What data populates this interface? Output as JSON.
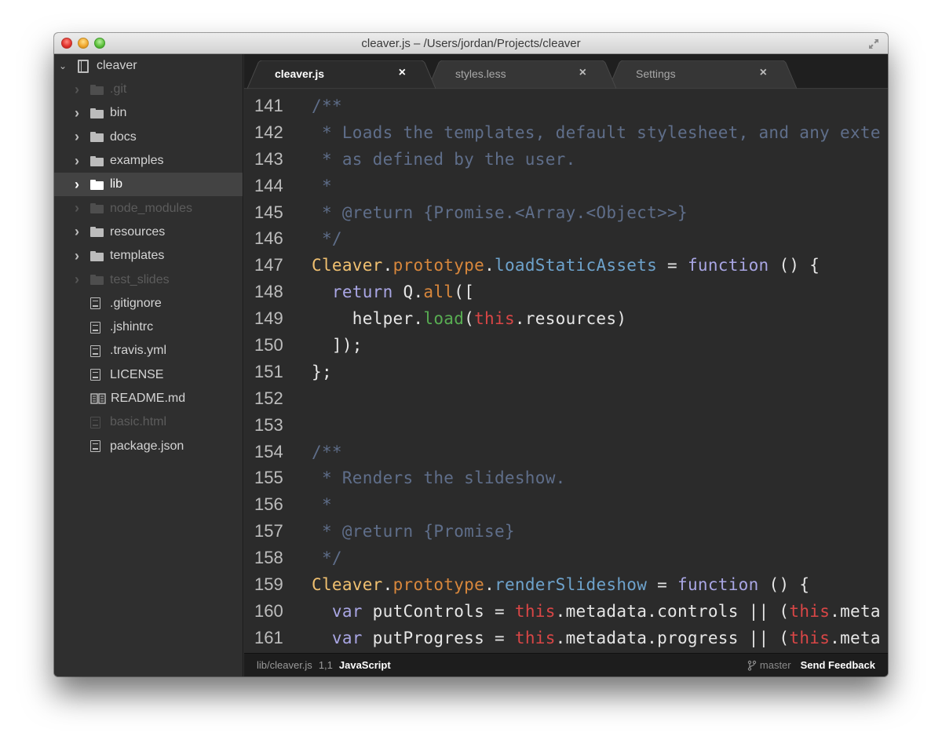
{
  "window": {
    "title": "cleaver.js – /Users/jordan/Projects/cleaver"
  },
  "sidebar": {
    "root": {
      "label": "cleaver",
      "icon": "repo-book-icon",
      "expanded": true
    },
    "items": [
      {
        "label": ".git",
        "type": "folder",
        "dim": true,
        "selected": false
      },
      {
        "label": "bin",
        "type": "folder",
        "dim": false,
        "selected": false
      },
      {
        "label": "docs",
        "type": "folder",
        "dim": false,
        "selected": false
      },
      {
        "label": "examples",
        "type": "folder",
        "dim": false,
        "selected": false
      },
      {
        "label": "lib",
        "type": "folder",
        "dim": false,
        "selected": true
      },
      {
        "label": "node_modules",
        "type": "folder",
        "dim": true,
        "selected": false
      },
      {
        "label": "resources",
        "type": "folder",
        "dim": false,
        "selected": false
      },
      {
        "label": "templates",
        "type": "folder",
        "dim": false,
        "selected": false
      },
      {
        "label": "test_slides",
        "type": "folder",
        "dim": true,
        "selected": false
      },
      {
        "label": ".gitignore",
        "type": "file",
        "dim": false,
        "selected": false
      },
      {
        "label": ".jshintrc",
        "type": "file",
        "dim": false,
        "selected": false
      },
      {
        "label": ".travis.yml",
        "type": "file",
        "dim": false,
        "selected": false
      },
      {
        "label": "LICENSE",
        "type": "file",
        "dim": false,
        "selected": false
      },
      {
        "label": "README.md",
        "type": "readme",
        "dim": false,
        "selected": false
      },
      {
        "label": "basic.html",
        "type": "file",
        "dim": true,
        "selected": false
      },
      {
        "label": "package.json",
        "type": "file",
        "dim": false,
        "selected": false
      }
    ]
  },
  "tabs": [
    {
      "label": "cleaver.js",
      "active": true,
      "close": "×"
    },
    {
      "label": "styles.less",
      "active": false,
      "close": "×"
    },
    {
      "label": "Settings",
      "active": false,
      "close": "×"
    }
  ],
  "editor": {
    "lines": [
      {
        "n": "141",
        "tokens": [
          [
            "comment",
            "/**"
          ]
        ]
      },
      {
        "n": "142",
        "tokens": [
          [
            "comment",
            " * Loads the templates, default stylesheet, and any exte"
          ]
        ]
      },
      {
        "n": "143",
        "tokens": [
          [
            "comment",
            " * as defined by the user."
          ]
        ]
      },
      {
        "n": "144",
        "tokens": [
          [
            "comment",
            " *"
          ]
        ]
      },
      {
        "n": "145",
        "tokens": [
          [
            "comment",
            " * @return {Promise.<Array.<Object>>}"
          ]
        ]
      },
      {
        "n": "146",
        "tokens": [
          [
            "comment",
            " */"
          ]
        ]
      },
      {
        "n": "147",
        "tokens": [
          [
            "class",
            "Cleaver"
          ],
          [
            "plain",
            "."
          ],
          [
            "proto",
            "prototype"
          ],
          [
            "plain",
            "."
          ],
          [
            "method",
            "loadStaticAssets"
          ],
          [
            "plain",
            " = "
          ],
          [
            "keyword",
            "function"
          ],
          [
            "plain",
            " () {"
          ]
        ]
      },
      {
        "n": "148",
        "tokens": [
          [
            "plain",
            "  "
          ],
          [
            "keyword",
            "return"
          ],
          [
            "plain",
            " Q."
          ],
          [
            "all",
            "all"
          ],
          [
            "plain",
            "(["
          ]
        ]
      },
      {
        "n": "149",
        "tokens": [
          [
            "plain",
            "    helper."
          ],
          [
            "call",
            "load"
          ],
          [
            "plain",
            "("
          ],
          [
            "this",
            "this"
          ],
          [
            "plain",
            ".resources)"
          ]
        ]
      },
      {
        "n": "150",
        "tokens": [
          [
            "plain",
            "  ]);"
          ]
        ]
      },
      {
        "n": "151",
        "tokens": [
          [
            "plain",
            "};"
          ]
        ]
      },
      {
        "n": "152",
        "tokens": []
      },
      {
        "n": "153",
        "tokens": []
      },
      {
        "n": "154",
        "tokens": [
          [
            "comment",
            "/**"
          ]
        ]
      },
      {
        "n": "155",
        "tokens": [
          [
            "comment",
            " * Renders the slideshow."
          ]
        ]
      },
      {
        "n": "156",
        "tokens": [
          [
            "comment",
            " *"
          ]
        ]
      },
      {
        "n": "157",
        "tokens": [
          [
            "comment",
            " * @return {Promise}"
          ]
        ]
      },
      {
        "n": "158",
        "tokens": [
          [
            "comment",
            " */"
          ]
        ]
      },
      {
        "n": "159",
        "tokens": [
          [
            "class",
            "Cleaver"
          ],
          [
            "plain",
            "."
          ],
          [
            "proto",
            "prototype"
          ],
          [
            "plain",
            "."
          ],
          [
            "method",
            "renderSlideshow"
          ],
          [
            "plain",
            " = "
          ],
          [
            "keyword",
            "function"
          ],
          [
            "plain",
            " () {"
          ]
        ]
      },
      {
        "n": "160",
        "tokens": [
          [
            "plain",
            "  "
          ],
          [
            "keyword",
            "var"
          ],
          [
            "plain",
            " putControls = "
          ],
          [
            "this",
            "this"
          ],
          [
            "plain",
            ".metadata.controls || ("
          ],
          [
            "this",
            "this"
          ],
          [
            "plain",
            ".meta"
          ]
        ]
      },
      {
        "n": "161",
        "tokens": [
          [
            "plain",
            "  "
          ],
          [
            "keyword",
            "var"
          ],
          [
            "plain",
            " putProgress = "
          ],
          [
            "this",
            "this"
          ],
          [
            "plain",
            ".metadata.progress || ("
          ],
          [
            "this",
            "this"
          ],
          [
            "plain",
            ".meta"
          ]
        ]
      }
    ]
  },
  "statusbar": {
    "file_path": "lib/cleaver.js",
    "cursor": "1,1",
    "language": "JavaScript",
    "branch": "master",
    "feedback": "Send Feedback"
  }
}
